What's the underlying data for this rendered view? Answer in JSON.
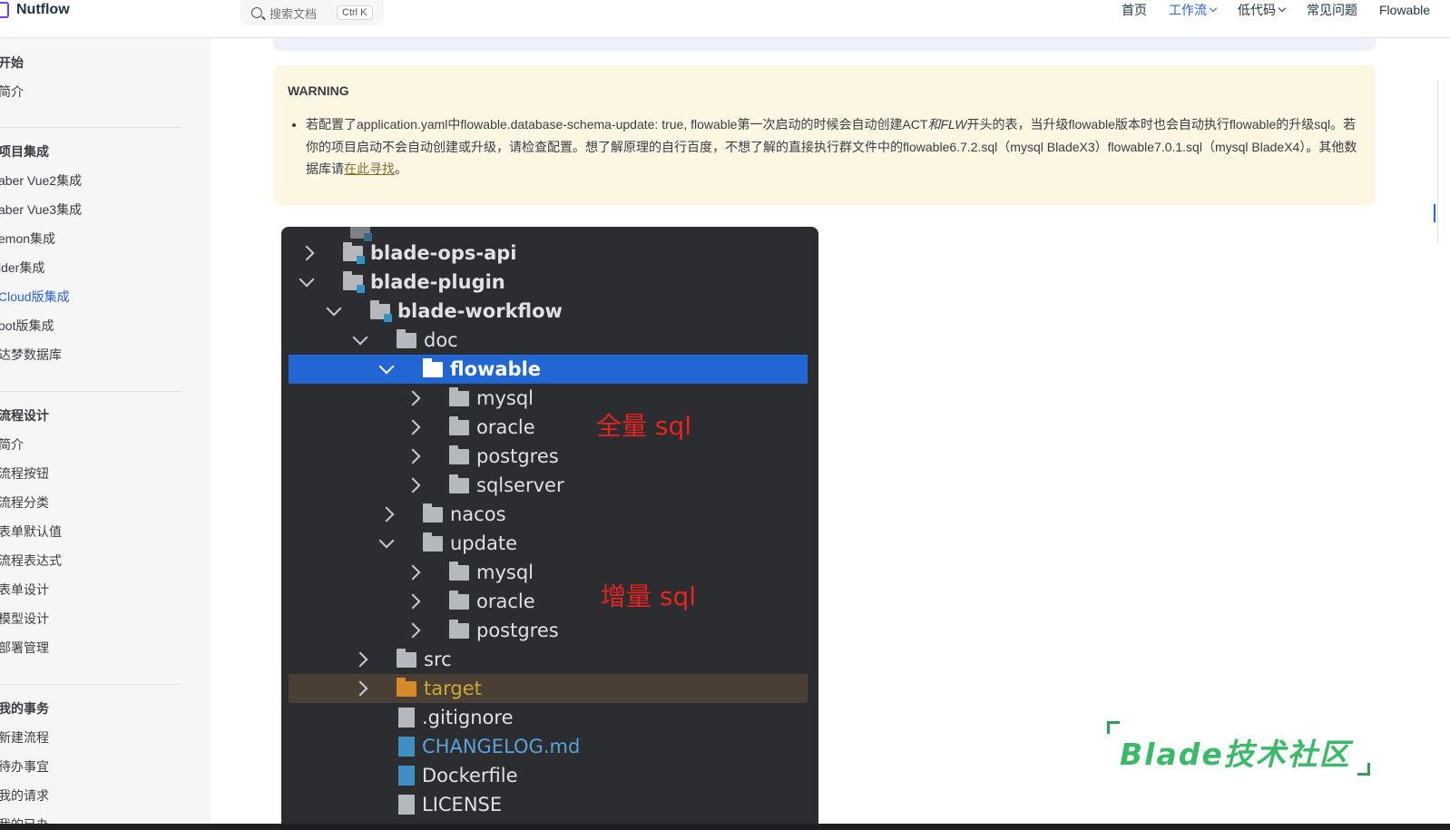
{
  "header": {
    "brand": "Nutflow",
    "search_placeholder": "搜索文档",
    "search_shortcut": "Ctrl K",
    "nav": [
      {
        "label": "首页"
      },
      {
        "label": "工作流"
      },
      {
        "label": "低代码"
      },
      {
        "label": "常见问题"
      },
      {
        "label": "Flowable"
      }
    ]
  },
  "sidebar": {
    "groups": [
      {
        "title": "开始",
        "items": [
          "简介"
        ]
      },
      {
        "title": "项目集成",
        "items": [
          "aber Vue2集成",
          "aber Vue3集成",
          "emon集成",
          "ider集成",
          "Cloud版集成",
          "oot版集成",
          "达梦数据库"
        ]
      },
      {
        "title": "流程设计",
        "items": [
          "简介",
          "流程按钮",
          "流程分类",
          "表单默认值",
          "流程表达式",
          "表单设计",
          "模型设计",
          "部署管理"
        ]
      },
      {
        "title": "我的事务",
        "items": [
          "新建流程",
          "待办事宜",
          "我的请求",
          "我的已办"
        ]
      }
    ],
    "active_item": "Cloud版集成"
  },
  "warning": {
    "title": "WARNING",
    "text_before": "若配置了application.yaml中flowable.database-schema-update: true, flowable第一次启动的时候会自动创建ACT",
    "text_italic": "和FLW",
    "text_after": "开头的表，当升级flowable版本时也会自动执行flowable的升级sql。若你的项目启动不会自动创建或升级，请检查配置。想了解原理的自行百度，不想了解的直接执行群文件中的flowable6.7.2.sql（mysql BladeX3）flowable7.0.1.sql（mysql BladeX4）。其他数据库请",
    "link": "在此寻找",
    "text_end": "。"
  },
  "ide_tree": {
    "rows": [
      {
        "label": "blade-ops-api",
        "arrow": "right"
      },
      {
        "label": "blade-plugin",
        "arrow": "down"
      },
      {
        "label": "blade-workflow",
        "arrow": "down"
      },
      {
        "label": "doc",
        "arrow": "down"
      },
      {
        "label": "flowable",
        "arrow": "down"
      },
      {
        "label": "mysql",
        "arrow": "right"
      },
      {
        "label": "oracle",
        "arrow": "right"
      },
      {
        "label": "postgres",
        "arrow": "right"
      },
      {
        "label": "sqlserver",
        "arrow": "right"
      },
      {
        "label": "nacos",
        "arrow": "right"
      },
      {
        "label": "update",
        "arrow": "down"
      },
      {
        "label": "mysql",
        "arrow": "right"
      },
      {
        "label": "oracle",
        "arrow": "right"
      },
      {
        "label": "postgres",
        "arrow": "right"
      },
      {
        "label": "src",
        "arrow": "right"
      },
      {
        "label": "target",
        "arrow": "right"
      },
      {
        "label": ".gitignore",
        "arrow": "none"
      },
      {
        "label": "CHANGELOG.md",
        "arrow": "none"
      },
      {
        "label": "Dockerfile",
        "arrow": "none"
      },
      {
        "label": "LICENSE",
        "arrow": "none"
      }
    ],
    "annotation_full": "全量 sql",
    "annotation_incremental": "增量 sql"
  },
  "watermark": "Blade技术社区",
  "colors": {
    "accent": "#2b62d1",
    "warning_bg": "#fcf6e3",
    "ide_bg": "#2b2d30",
    "selection": "#2166d2",
    "annotation": "#e8241e",
    "watermark": "#3bb868"
  }
}
